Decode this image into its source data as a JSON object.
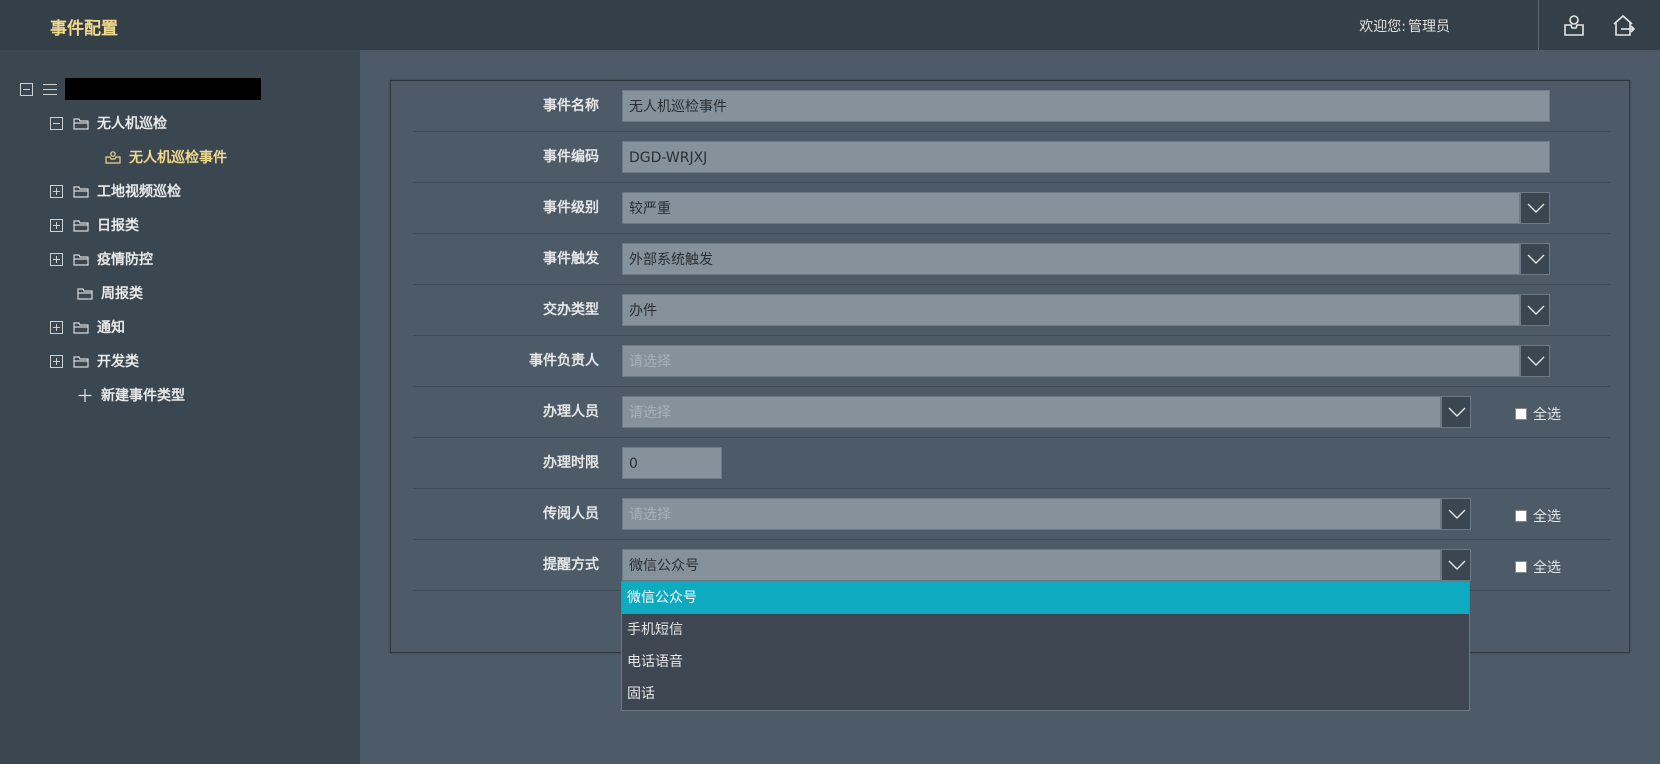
{
  "header": {
    "title": "事件配置",
    "welcome_prefix": "欢迎您:",
    "user_name": "管理员"
  },
  "sidebar": {
    "root": {
      "expanded": true
    },
    "items": [
      {
        "label": "无人机巡检",
        "expander": "minus",
        "level": 1
      },
      {
        "label": "无人机巡检事件",
        "expander": "none",
        "level": 2,
        "selected": true,
        "icon": "inbox-icon"
      },
      {
        "label": "工地视频巡检",
        "expander": "plus",
        "level": 1
      },
      {
        "label": "日报类",
        "expander": "plus",
        "level": 1
      },
      {
        "label": "疫情防控",
        "expander": "plus",
        "level": 1
      },
      {
        "label": "周报类",
        "expander": "none",
        "level": 1
      },
      {
        "label": "通知",
        "expander": "plus",
        "level": 1
      },
      {
        "label": "开发类",
        "expander": "plus",
        "level": 1
      }
    ],
    "new_type_label": "新建事件类型"
  },
  "form": {
    "event_name": {
      "label": "事件名称",
      "value": "无人机巡检事件"
    },
    "event_code": {
      "label": "事件编码",
      "value": "DGD-WRJXJ"
    },
    "event_level": {
      "label": "事件级别",
      "value": "较严重"
    },
    "event_trigger": {
      "label": "事件触发",
      "value": "外部系统触发"
    },
    "assign_type": {
      "label": "交办类型",
      "value": "办件"
    },
    "event_owner": {
      "label": "事件负责人",
      "placeholder": "请选择"
    },
    "handlers": {
      "label": "办理人员",
      "placeholder": "请选择",
      "select_all": "全选"
    },
    "time_limit": {
      "label": "办理时限",
      "value": "0"
    },
    "readers": {
      "label": "传阅人员",
      "placeholder": "请选择",
      "select_all": "全选"
    },
    "remind": {
      "label": "提醒方式",
      "value": "微信公众号",
      "select_all": "全选"
    }
  },
  "remind_options": [
    "微信公众号",
    "手机短信",
    "电话语音",
    "固话"
  ],
  "colors": {
    "accent": "#0eaabf",
    "title": "#f0d88c",
    "header_bg": "#343f48",
    "sidebar_bg": "#3a4650",
    "content_bg": "#4d5a68"
  }
}
